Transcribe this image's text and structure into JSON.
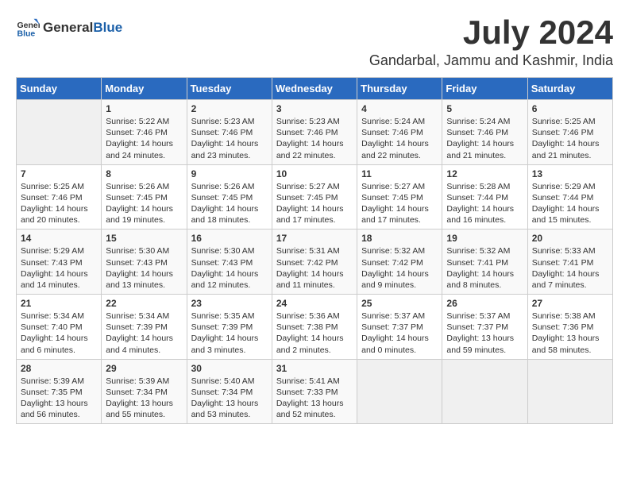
{
  "logo": {
    "general": "General",
    "blue": "Blue"
  },
  "title": "July 2024",
  "location": "Gandarbal, Jammu and Kashmir, India",
  "headers": [
    "Sunday",
    "Monday",
    "Tuesday",
    "Wednesday",
    "Thursday",
    "Friday",
    "Saturday"
  ],
  "weeks": [
    [
      {
        "day": "",
        "content": ""
      },
      {
        "day": "1",
        "content": "Sunrise: 5:22 AM\nSunset: 7:46 PM\nDaylight: 14 hours\nand 24 minutes."
      },
      {
        "day": "2",
        "content": "Sunrise: 5:23 AM\nSunset: 7:46 PM\nDaylight: 14 hours\nand 23 minutes."
      },
      {
        "day": "3",
        "content": "Sunrise: 5:23 AM\nSunset: 7:46 PM\nDaylight: 14 hours\nand 22 minutes."
      },
      {
        "day": "4",
        "content": "Sunrise: 5:24 AM\nSunset: 7:46 PM\nDaylight: 14 hours\nand 22 minutes."
      },
      {
        "day": "5",
        "content": "Sunrise: 5:24 AM\nSunset: 7:46 PM\nDaylight: 14 hours\nand 21 minutes."
      },
      {
        "day": "6",
        "content": "Sunrise: 5:25 AM\nSunset: 7:46 PM\nDaylight: 14 hours\nand 21 minutes."
      }
    ],
    [
      {
        "day": "7",
        "content": "Sunrise: 5:25 AM\nSunset: 7:46 PM\nDaylight: 14 hours\nand 20 minutes."
      },
      {
        "day": "8",
        "content": "Sunrise: 5:26 AM\nSunset: 7:45 PM\nDaylight: 14 hours\nand 19 minutes."
      },
      {
        "day": "9",
        "content": "Sunrise: 5:26 AM\nSunset: 7:45 PM\nDaylight: 14 hours\nand 18 minutes."
      },
      {
        "day": "10",
        "content": "Sunrise: 5:27 AM\nSunset: 7:45 PM\nDaylight: 14 hours\nand 17 minutes."
      },
      {
        "day": "11",
        "content": "Sunrise: 5:27 AM\nSunset: 7:45 PM\nDaylight: 14 hours\nand 17 minutes."
      },
      {
        "day": "12",
        "content": "Sunrise: 5:28 AM\nSunset: 7:44 PM\nDaylight: 14 hours\nand 16 minutes."
      },
      {
        "day": "13",
        "content": "Sunrise: 5:29 AM\nSunset: 7:44 PM\nDaylight: 14 hours\nand 15 minutes."
      }
    ],
    [
      {
        "day": "14",
        "content": "Sunrise: 5:29 AM\nSunset: 7:43 PM\nDaylight: 14 hours\nand 14 minutes."
      },
      {
        "day": "15",
        "content": "Sunrise: 5:30 AM\nSunset: 7:43 PM\nDaylight: 14 hours\nand 13 minutes."
      },
      {
        "day": "16",
        "content": "Sunrise: 5:30 AM\nSunset: 7:43 PM\nDaylight: 14 hours\nand 12 minutes."
      },
      {
        "day": "17",
        "content": "Sunrise: 5:31 AM\nSunset: 7:42 PM\nDaylight: 14 hours\nand 11 minutes."
      },
      {
        "day": "18",
        "content": "Sunrise: 5:32 AM\nSunset: 7:42 PM\nDaylight: 14 hours\nand 9 minutes."
      },
      {
        "day": "19",
        "content": "Sunrise: 5:32 AM\nSunset: 7:41 PM\nDaylight: 14 hours\nand 8 minutes."
      },
      {
        "day": "20",
        "content": "Sunrise: 5:33 AM\nSunset: 7:41 PM\nDaylight: 14 hours\nand 7 minutes."
      }
    ],
    [
      {
        "day": "21",
        "content": "Sunrise: 5:34 AM\nSunset: 7:40 PM\nDaylight: 14 hours\nand 6 minutes."
      },
      {
        "day": "22",
        "content": "Sunrise: 5:34 AM\nSunset: 7:39 PM\nDaylight: 14 hours\nand 4 minutes."
      },
      {
        "day": "23",
        "content": "Sunrise: 5:35 AM\nSunset: 7:39 PM\nDaylight: 14 hours\nand 3 minutes."
      },
      {
        "day": "24",
        "content": "Sunrise: 5:36 AM\nSunset: 7:38 PM\nDaylight: 14 hours\nand 2 minutes."
      },
      {
        "day": "25",
        "content": "Sunrise: 5:37 AM\nSunset: 7:37 PM\nDaylight: 14 hours\nand 0 minutes."
      },
      {
        "day": "26",
        "content": "Sunrise: 5:37 AM\nSunset: 7:37 PM\nDaylight: 13 hours\nand 59 minutes."
      },
      {
        "day": "27",
        "content": "Sunrise: 5:38 AM\nSunset: 7:36 PM\nDaylight: 13 hours\nand 58 minutes."
      }
    ],
    [
      {
        "day": "28",
        "content": "Sunrise: 5:39 AM\nSunset: 7:35 PM\nDaylight: 13 hours\nand 56 minutes."
      },
      {
        "day": "29",
        "content": "Sunrise: 5:39 AM\nSunset: 7:34 PM\nDaylight: 13 hours\nand 55 minutes."
      },
      {
        "day": "30",
        "content": "Sunrise: 5:40 AM\nSunset: 7:34 PM\nDaylight: 13 hours\nand 53 minutes."
      },
      {
        "day": "31",
        "content": "Sunrise: 5:41 AM\nSunset: 7:33 PM\nDaylight: 13 hours\nand 52 minutes."
      },
      {
        "day": "",
        "content": ""
      },
      {
        "day": "",
        "content": ""
      },
      {
        "day": "",
        "content": ""
      }
    ]
  ]
}
